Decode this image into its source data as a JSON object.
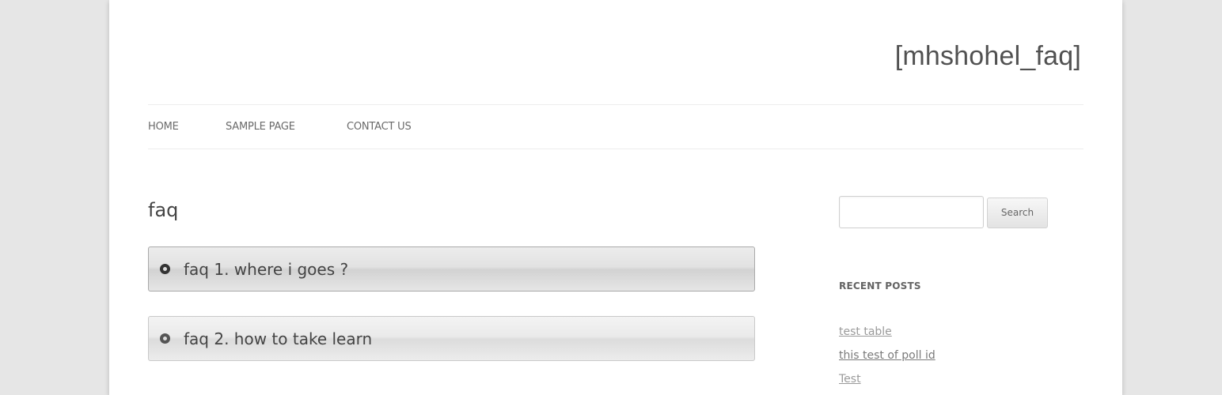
{
  "site": {
    "title": "[mhshohel_faq]"
  },
  "nav": {
    "items": [
      "HOME",
      "SAMPLE PAGE",
      "CONTACT US"
    ]
  },
  "page": {
    "title": "faq",
    "faq_items": [
      {
        "label": "faq 1. where i goes ?",
        "state": "active"
      },
      {
        "label": "faq 2. how to take learn",
        "state": "collapsed"
      }
    ]
  },
  "sidebar": {
    "search": {
      "value": "",
      "placeholder": "",
      "button_label": "Search"
    },
    "recent_posts": {
      "title": "RECENT POSTS",
      "items": [
        "test table",
        "this test of poll id",
        "Test"
      ]
    }
  },
  "colors": {
    "background": "#e6e6e6",
    "page": "#ffffff",
    "text": "#444444",
    "link": "#9a9a9a"
  }
}
